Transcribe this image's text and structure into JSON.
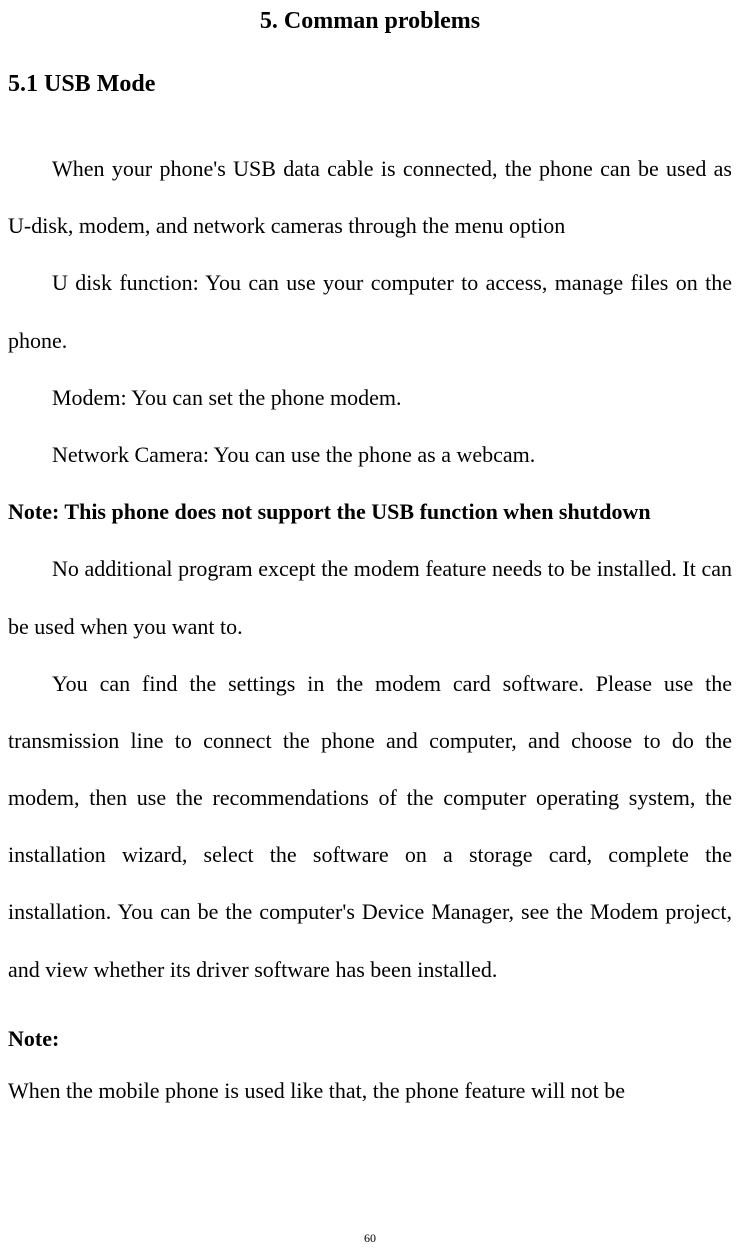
{
  "chapter": {
    "title": "5. Comman problems"
  },
  "section": {
    "title": "5.1 USB Mode"
  },
  "paragraphs": {
    "p1": "When your phone's USB data cable is connected, the phone can be used as U-disk, modem, and network cameras through the menu option",
    "p2": "U disk function: You can use your computer to access, manage files on the phone.",
    "p3": "Modem: You can set the phone modem.",
    "p4": "Network Camera: You can use the phone as a webcam.",
    "note1": "Note: This phone does not support the USB function when shutdown",
    "p5": "No additional program except the modem feature needs to be installed. It can be used when you want to.",
    "p6": "You can find the settings in the modem card software. Please use the transmission line to connect the phone and computer, and choose to do the modem, then use the recommendations of the computer operating system, the installation wizard, select the software on a storage card, complete the installation. You can be the computer's Device Manager, see the Modem project, and view whether its driver software has been installed.",
    "note2_label": "Note:",
    "p7": "When the mobile phone is used like that, the phone feature will not be"
  },
  "page_number": "60"
}
